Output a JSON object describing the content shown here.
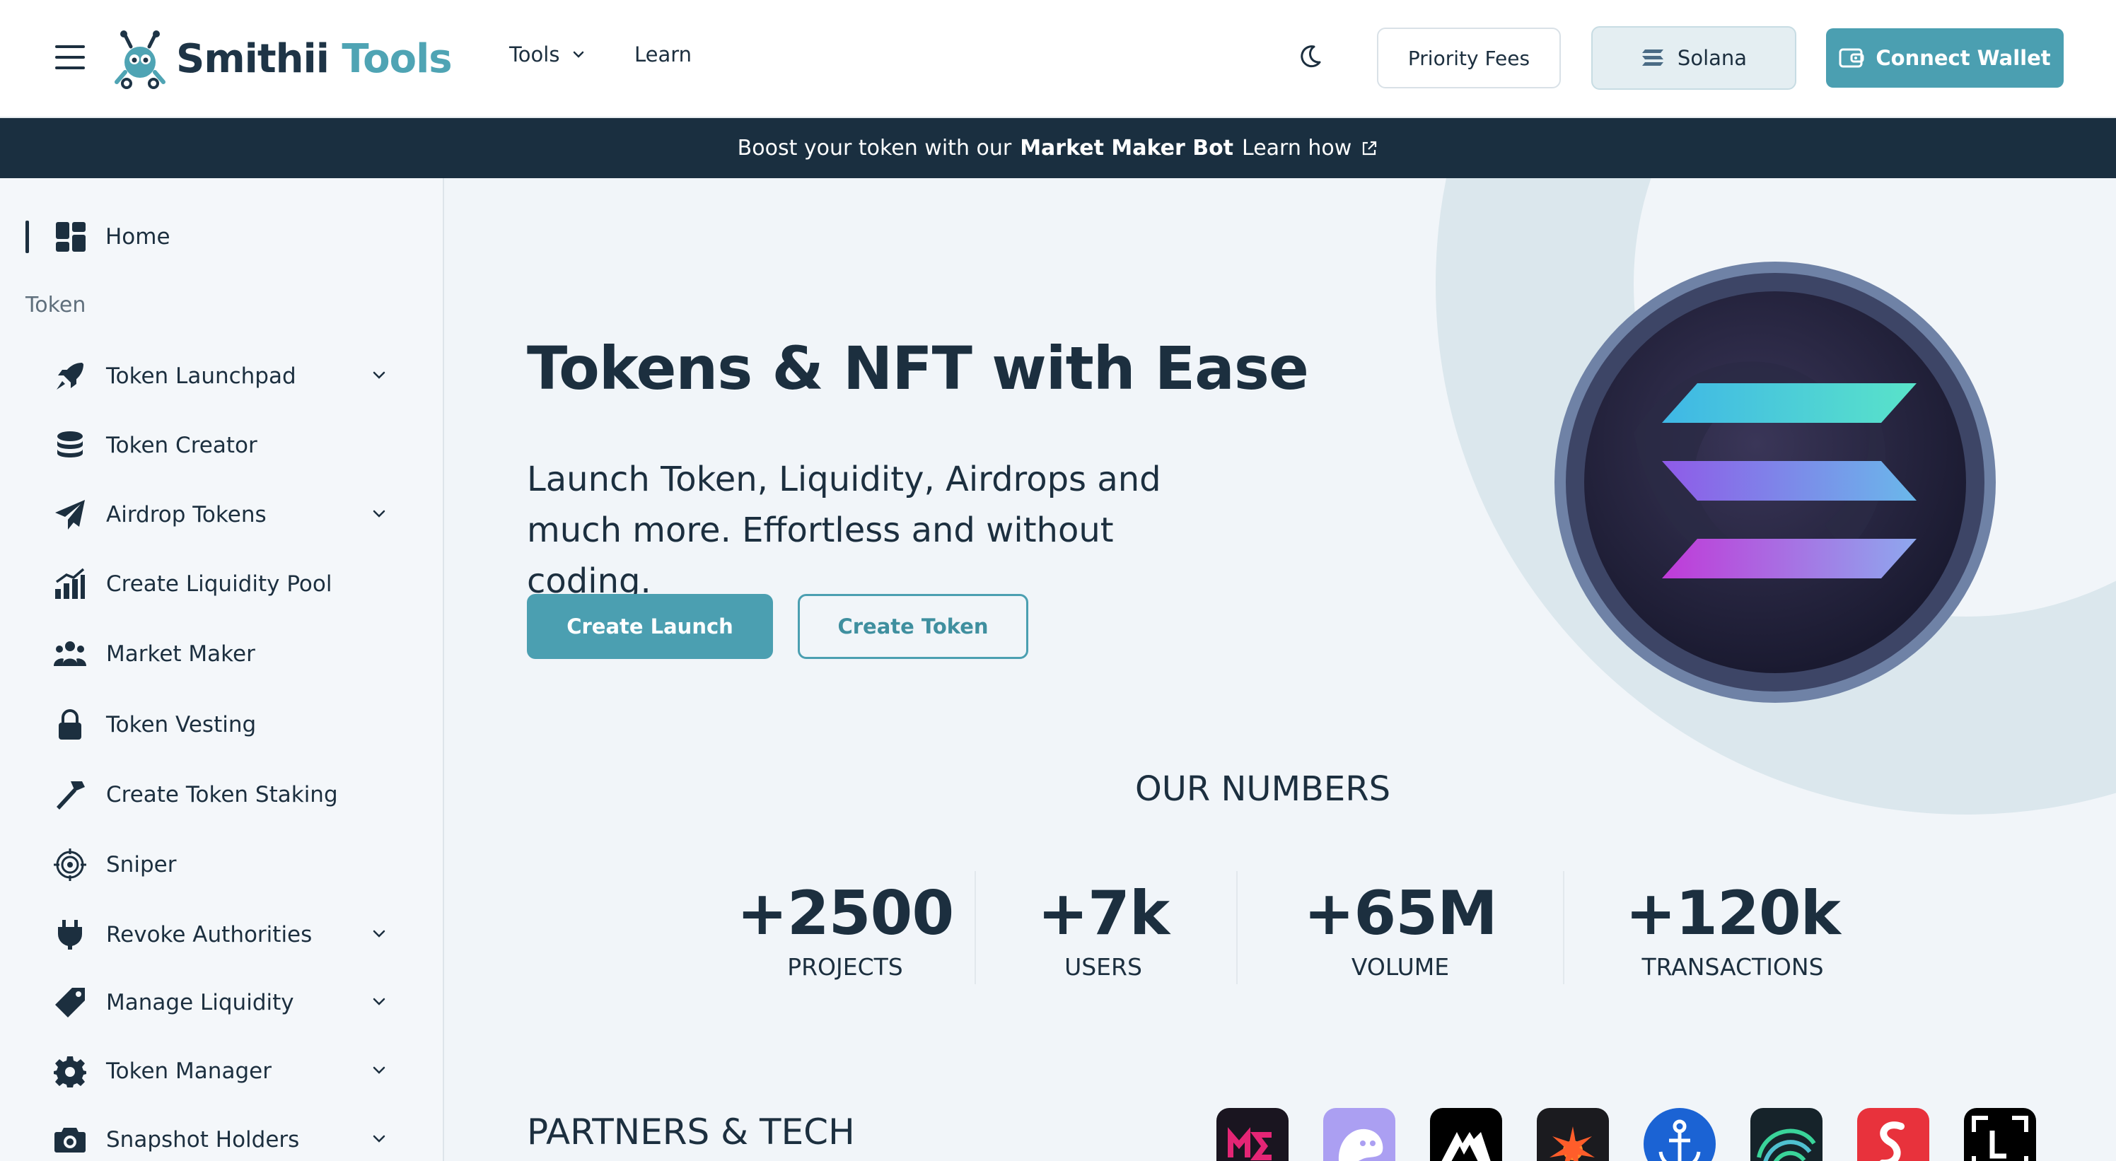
{
  "header": {
    "logo_main": "Smithii",
    "logo_accent": "Tools",
    "nav": [
      {
        "label": "Tools",
        "has_dropdown": true
      },
      {
        "label": "Learn"
      }
    ],
    "priority_fees": "Priority Fees",
    "network": "Solana",
    "connect_wallet": "Connect Wallet"
  },
  "banner": {
    "prefix": "Boost your token with our",
    "highlight": "Market Maker Bot",
    "link": "Learn how"
  },
  "sidebar": {
    "home": "Home",
    "section": "Token",
    "items": [
      {
        "label": "Token Launchpad",
        "icon": "rocket-icon",
        "has_dropdown": true
      },
      {
        "label": "Token Creator",
        "icon": "coins-stack-icon"
      },
      {
        "label": "Airdrop Tokens",
        "icon": "paper-plane-icon",
        "has_dropdown": true
      },
      {
        "label": "Create Liquidity Pool",
        "icon": "chart-up-icon"
      },
      {
        "label": "Market Maker",
        "icon": "users-icon"
      },
      {
        "label": "Token Vesting",
        "icon": "lock-icon"
      },
      {
        "label": "Create Token Staking",
        "icon": "hammer-icon"
      },
      {
        "label": "Sniper",
        "icon": "target-icon"
      },
      {
        "label": "Revoke Authorities",
        "icon": "plug-icon",
        "has_dropdown": true
      },
      {
        "label": "Manage Liquidity",
        "icon": "tag-icon",
        "has_dropdown": true
      },
      {
        "label": "Token Manager",
        "icon": "gear-icon",
        "has_dropdown": true
      },
      {
        "label": "Snapshot Holders",
        "icon": "camera-icon",
        "has_dropdown": true
      }
    ]
  },
  "hero": {
    "title": "Tokens & NFT with Ease",
    "subtitle": "Launch Token, Liquidity, Airdrops and much more. Effortless and without coding.",
    "primary_cta": "Create Launch",
    "secondary_cta": "Create Token"
  },
  "numbers": {
    "title": "OUR NUMBERS",
    "stats": [
      {
        "value": "+2500",
        "label": "PROJECTS"
      },
      {
        "value": "+7k",
        "label": "USERS"
      },
      {
        "value": "+65M",
        "label": "VOLUME"
      },
      {
        "value": "+120k",
        "label": "TRANSACTIONS"
      }
    ]
  },
  "partners": {
    "title": "PARTNERS & TECH",
    "logos": [
      "magic-eden-logo",
      "phantom-logo",
      "meteora-logo",
      "raydium-logo",
      "anchor-logo",
      "helius-logo",
      "solflare-logo",
      "frame-logo"
    ]
  },
  "colors": {
    "accent": "#4b9fb1",
    "dark": "#1a2f40",
    "text": "#1c2f3f"
  }
}
